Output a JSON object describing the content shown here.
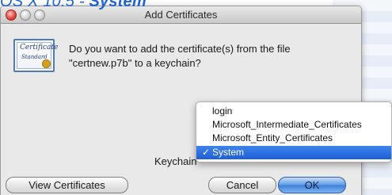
{
  "header": {
    "caption_prefix": "OS X 10.5 - ",
    "caption_emphasis": "System"
  },
  "window": {
    "title": "Add Certificates",
    "controls": [
      "close",
      "minimize",
      "zoom"
    ]
  },
  "certificate_icon": {
    "line1": "Certificate",
    "line2": "Standard",
    "icon_name": "certificate-icon"
  },
  "message": "Do you want to add the certificate(s) from the file\n\"certnew.p7b\" to a keychain?",
  "keychain": {
    "label": "Keychain",
    "menu_items": [
      {
        "label": "login",
        "checked": false
      },
      {
        "label": "Microsoft_Intermediate_Certificates",
        "checked": false
      },
      {
        "label": "Microsoft_Entity_Certificates",
        "checked": false
      },
      {
        "label": "System",
        "checked": true
      }
    ],
    "check_glyph": "✓"
  },
  "buttons": {
    "view_certificates": "View Certificates",
    "cancel": "Cancel",
    "ok": "OK"
  },
  "colors": {
    "caption": "#1f63d3",
    "selection": "#1e5fd6",
    "close_light": "#e2443a"
  }
}
